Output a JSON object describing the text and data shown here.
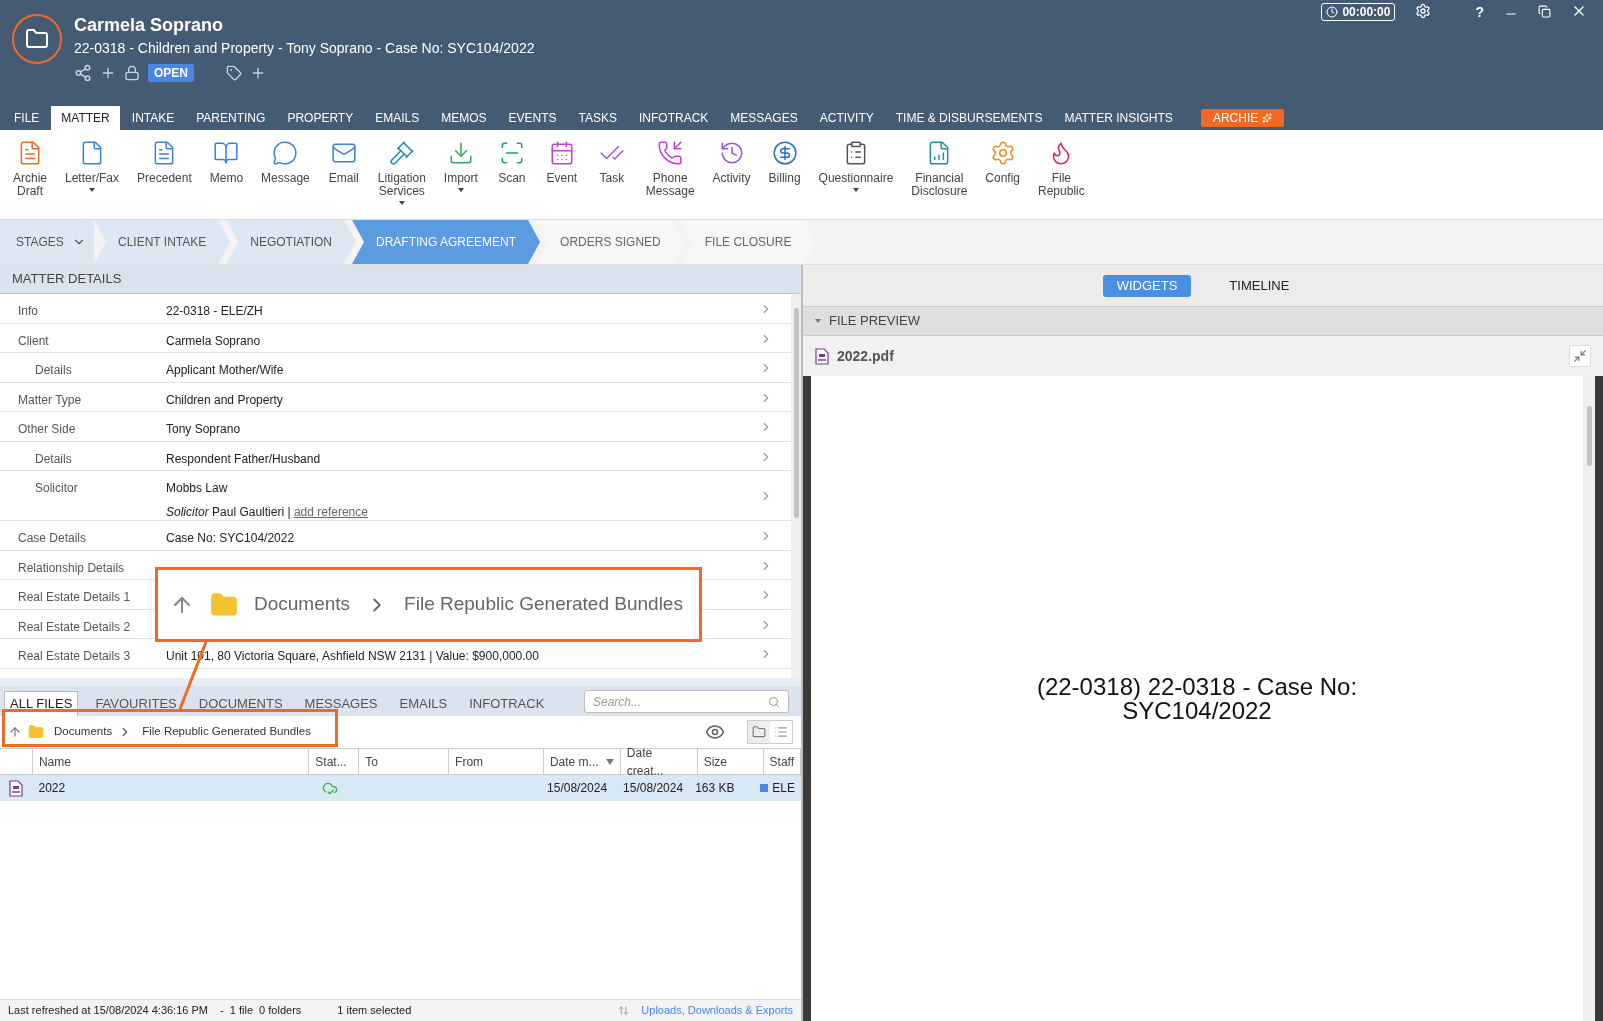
{
  "header": {
    "title": "Carmela Soprano",
    "subtitle": "22-0318 - Children and Property - Tony Soprano - Case No: SYC104/2022",
    "status_badge": "OPEN",
    "timer": "00:00:00",
    "help": "?"
  },
  "tabs": [
    {
      "label": "FILE",
      "selected": false,
      "kind": "tab"
    },
    {
      "label": "MATTER",
      "selected": true,
      "kind": "tab"
    },
    {
      "label": "INTAKE",
      "selected": false,
      "kind": "tab"
    },
    {
      "label": "PARENTING",
      "selected": false,
      "kind": "tab"
    },
    {
      "label": "PROPERTY",
      "selected": false,
      "kind": "tab"
    },
    {
      "label": "EMAILS",
      "selected": false,
      "kind": "tab"
    },
    {
      "label": "MEMOS",
      "selected": false,
      "kind": "tab"
    },
    {
      "label": "EVENTS",
      "selected": false,
      "kind": "tab"
    },
    {
      "label": "TASKS",
      "selected": false,
      "kind": "tab"
    },
    {
      "label": "INFOTRACK",
      "selected": false,
      "kind": "tab"
    },
    {
      "label": "MESSAGES",
      "selected": false,
      "kind": "tab"
    },
    {
      "label": "ACTIVITY",
      "selected": false,
      "kind": "tab"
    },
    {
      "label": "TIME & DISBURSEMENTS",
      "selected": false,
      "kind": "tab"
    },
    {
      "label": "MATTER INSIGHTS",
      "selected": false,
      "kind": "tab"
    },
    {
      "label": "ARCHIE",
      "selected": false,
      "kind": "highlight"
    }
  ],
  "toolbar": [
    {
      "label": "Archie\nDraft",
      "color": "#f06a25",
      "dropdown": false
    },
    {
      "label": "Letter/Fax",
      "color": "#3b82d6",
      "dropdown": true
    },
    {
      "label": "Precedent",
      "color": "#3b82d6",
      "dropdown": false
    },
    {
      "label": "Memo",
      "color": "#3b82d6",
      "dropdown": false
    },
    {
      "label": "Message",
      "color": "#3b82d6",
      "dropdown": false
    },
    {
      "label": "Email",
      "color": "#3b82d6",
      "dropdown": false
    },
    {
      "label": "Litigation\nServices",
      "color": "#1f8fa6",
      "dropdown": true
    },
    {
      "label": "Import",
      "color": "#2eaa5c",
      "dropdown": true
    },
    {
      "label": "Scan",
      "color": "#1aa37a",
      "dropdown": false
    },
    {
      "label": "Event",
      "color": "#c43fd1",
      "dropdown": false
    },
    {
      "label": "Task",
      "color": "#9b59d0",
      "dropdown": false
    },
    {
      "label": "Phone\nMessage",
      "color": "#c43fd1",
      "dropdown": false
    },
    {
      "label": "Activity",
      "color": "#9b59d0",
      "dropdown": false
    },
    {
      "label": "Billing",
      "color": "#2a6fc9",
      "dropdown": false
    },
    {
      "label": "Questionnaire",
      "color": "#555555",
      "dropdown": true
    },
    {
      "label": "Financial\nDisclosure",
      "color": "#1f8fa6",
      "dropdown": false
    },
    {
      "label": "Config",
      "color": "#f08a25",
      "dropdown": false
    },
    {
      "label": "File\nRepublic",
      "color": "#d6264f",
      "dropdown": false
    }
  ],
  "stages": {
    "menu": "STAGES",
    "items": [
      {
        "label": "CLIENT INTAKE",
        "selected": false
      },
      {
        "label": "NEGOTIATION",
        "selected": false
      },
      {
        "label": "DRAFTING AGREEMENT",
        "selected": true
      },
      {
        "label": "ORDERS SIGNED",
        "selected": false
      },
      {
        "label": "FILE CLOSURE",
        "selected": false
      }
    ]
  },
  "matter_details": {
    "title": "MATTER DETAILS",
    "rows": [
      {
        "label": "Info",
        "value": "22-0318 - ELE/ZH",
        "indent": false
      },
      {
        "label": "Client",
        "value": "Carmela Soprano",
        "indent": false
      },
      {
        "label": "Details",
        "value": "Applicant Mother/Wife",
        "indent": true
      },
      {
        "label": "Matter Type",
        "value": "Children and Property",
        "indent": false
      },
      {
        "label": "Other Side",
        "value": "Tony Soprano",
        "indent": false
      },
      {
        "label": "Details",
        "value": "Respondent Father/Husband",
        "indent": true
      },
      {
        "label": "Solicitor",
        "value": "Mobbs Law",
        "indent": true,
        "role": "Solicitor",
        "person": "Paul Gaultieri",
        "separator": "|",
        "link": "add reference"
      },
      {
        "label": "Case Details",
        "value": "Case No: SYC104/2022",
        "indent": false
      },
      {
        "label": "Relationship Details",
        "indent": false
      },
      {
        "label": "Real Estate Details 1",
        "indent": false
      },
      {
        "label": "Real Estate Details 2",
        "indent": false
      },
      {
        "label": "Real Estate Details 3",
        "value": "Unit 101, 80 Victoria Square, Ashfield NSW 2131 | Value: $900,000.00",
        "indent": false
      }
    ]
  },
  "files": {
    "tabs": [
      {
        "label": "ALL FILES",
        "selected": true
      },
      {
        "label": "FAVOURITES",
        "selected": false
      },
      {
        "label": "DOCUMENTS",
        "selected": false
      },
      {
        "label": "MESSAGES",
        "selected": false
      },
      {
        "label": "EMAILS",
        "selected": false
      },
      {
        "label": "INFOTRACK",
        "selected": false
      }
    ],
    "search": {
      "placeholder": "Search..."
    },
    "breadcrumb": [
      "Documents",
      "File Republic Generated Bundles"
    ],
    "columns": [
      {
        "label": "Name",
        "sorted": false
      },
      {
        "label": "Stat...",
        "sorted": false
      },
      {
        "label": "To",
        "sorted": false
      },
      {
        "label": "From",
        "sorted": false
      },
      {
        "label": "Date m...",
        "sorted": true
      },
      {
        "label": "Date creat...",
        "sorted": false
      },
      {
        "label": "Size",
        "sorted": false
      },
      {
        "label": "Staff",
        "sorted": false
      }
    ],
    "rows": [
      {
        "name": "2022",
        "to": "",
        "from": "",
        "date_modified": "15/08/2024",
        "date_created": "15/08/2024",
        "size": "163 KB",
        "staff": "ELE",
        "color": "#4a86e8",
        "selected": true
      }
    ]
  },
  "status_bar": {
    "refreshed": "Last refreshed at 15/08/2024 4:36:16 PM",
    "counts": "-  1 file  0 folders",
    "selection": "1 item selected",
    "link": "Uploads, Downloads & Exports"
  },
  "preview": {
    "tabs": [
      {
        "label": "WIDGETS",
        "selected": true
      },
      {
        "label": "TIMELINE",
        "selected": false
      }
    ],
    "section": "FILE PREVIEW",
    "expanded": true,
    "file_name": "2022.pdf",
    "document_text": "(22-0318) 22-0318 - Case No: SYC104/2022"
  },
  "callout": {
    "breadcrumb": [
      "Documents",
      "File Republic Generated Bundles"
    ]
  }
}
